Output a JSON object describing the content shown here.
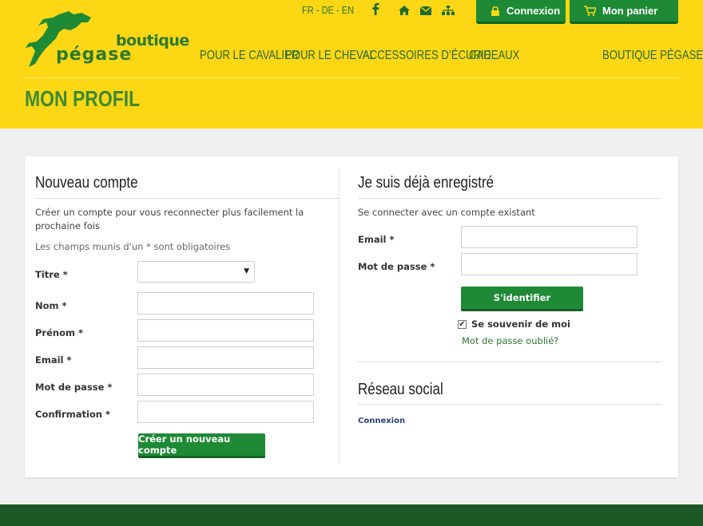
{
  "brand": {
    "word1": "boutique",
    "word2": "pégase"
  },
  "lang": {
    "fr": "FR",
    "de": "DE",
    "en": "EN",
    "sep": " - "
  },
  "top_icons": [
    "facebook-icon",
    "home-icon",
    "mail-icon",
    "sitemap-icon"
  ],
  "buttons": {
    "login": "Connexion",
    "cart": "Mon panier"
  },
  "nav": {
    "items": [
      "POUR LE CAVALIER",
      "POUR LE CHEVAL",
      "ACCESSOIRES D’ÉCURIE",
      "CADEAUX"
    ],
    "right": "BOUTIQUE PÉGASE"
  },
  "page_title": "MON PROFIL",
  "new_account": {
    "title": "Nouveau compte",
    "intro": "Créer un compte pour vous reconnecter plus facilement la prochaine fois",
    "required_note": "Les champs munis d'un * sont obligatoires",
    "fields": {
      "titre": "Titre *",
      "nom": "Nom *",
      "prenom": "Prénom *",
      "email": "Email *",
      "password": "Mot de passe *",
      "confirm": "Confirmation *"
    },
    "titre_value": "",
    "submit": "Créer un nouveau compte"
  },
  "existing": {
    "title": "Je suis déjà enregistré",
    "intro": "Se connecter avec un compte existant",
    "email_label": "Email *",
    "password_label": "Mot de passe *",
    "submit": "S'identifier",
    "remember": "Se souvenir de moi",
    "remember_checked": true,
    "forgot": "Mot de passe oublié?"
  },
  "social": {
    "title": "Réseau social",
    "login": "Connexion"
  },
  "colors": {
    "yellow": "#fdd714",
    "green": "#1e8a36",
    "dark_green": "#1b5a26",
    "text_green": "#2b7a2e"
  }
}
